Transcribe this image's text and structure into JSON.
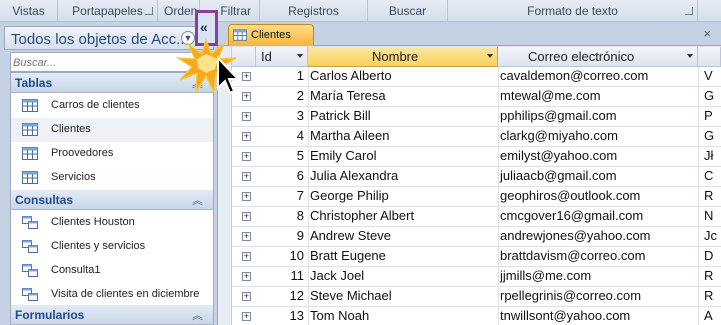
{
  "ribbon": {
    "groups": [
      "Vistas",
      "Portapapeles",
      "Orden",
      "Filtrar",
      "Registros",
      "Buscar",
      "Formato de texto"
    ]
  },
  "nav": {
    "title": "Todos los objetos de Acc...",
    "search_placeholder": "Buscar...",
    "sections": [
      {
        "label": "Tablas",
        "items": [
          "Carros de clientes",
          "Clientes",
          "Proovedores",
          "Servicios"
        ]
      },
      {
        "label": "Consultas",
        "items": [
          "Clientes Houston",
          "Clientes y servicios",
          "Consulta1",
          "Visita de clientes en diciembre"
        ]
      },
      {
        "label": "Formularios",
        "items": []
      }
    ],
    "collapse_glyph": "«"
  },
  "document": {
    "tab_label": "Clientes",
    "close_glyph": "×",
    "columns": [
      "Id",
      "Nombre",
      "Correo electrónico"
    ],
    "rows": [
      {
        "id": "1",
        "nombre": "Carlos Alberto",
        "correo": "cavaldemon@correo.com",
        "more": "V"
      },
      {
        "id": "2",
        "nombre": "María Teresa",
        "correo": "mtewal@me.com",
        "more": "G"
      },
      {
        "id": "3",
        "nombre": "Patrick Bill",
        "correo": "pphilips@gmail.com",
        "more": "P"
      },
      {
        "id": "4",
        "nombre": "Martha Aileen",
        "correo": "clarkg@miyaho.com",
        "more": "G"
      },
      {
        "id": "5",
        "nombre": "Emily Carol",
        "correo": "emilyst@yahoo.com",
        "more": "Jł"
      },
      {
        "id": "6",
        "nombre": "Julia Alexandra",
        "correo": "juliaacb@gmail.com",
        "more": "C"
      },
      {
        "id": "7",
        "nombre": "George Philip",
        "correo": "geophiros@outlook.com",
        "more": "R"
      },
      {
        "id": "8",
        "nombre": "Christopher Albert",
        "correo": "cmcgover16@gmail.com",
        "more": "N"
      },
      {
        "id": "9",
        "nombre": "Andrew Steve",
        "correo": "andrewjones@yahoo.com",
        "more": "Jc"
      },
      {
        "id": "10",
        "nombre": "Bratt Eugene",
        "correo": "brattdavism@correo.com",
        "more": "D"
      },
      {
        "id": "11",
        "nombre": "Jack Joel",
        "correo": "jjmills@me.com",
        "more": "R"
      },
      {
        "id": "12",
        "nombre": "Steve Michael",
        "correo": "rpellegrinis@correo.com",
        "more": "R"
      },
      {
        "id": "13",
        "nombre": "Tom Noah",
        "correo": "tnwillsont@yahoo.com",
        "more": "A"
      }
    ]
  },
  "colors": {
    "highlight_border": "#8a3f9a",
    "tab_active": "#f9b33c",
    "nav_bg": "#c5d2e4",
    "section_text": "#1f4a8c"
  }
}
